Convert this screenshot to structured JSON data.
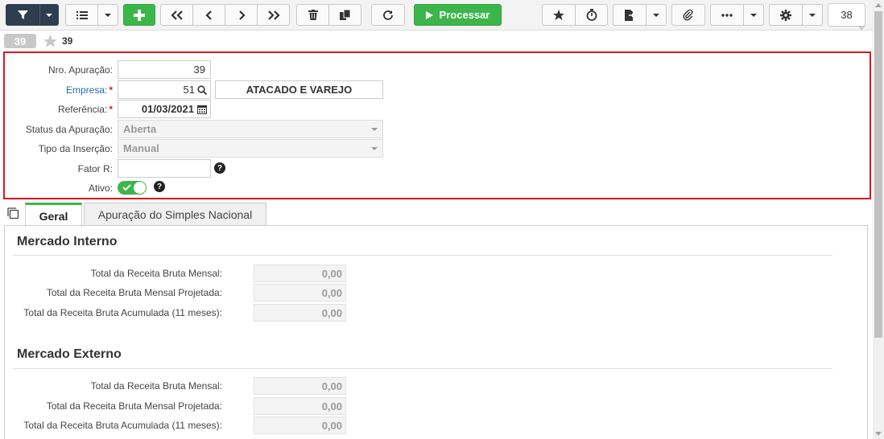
{
  "toolbar": {
    "process_label": "Processar",
    "record_counter": "38",
    "icons": [
      "filter-icon",
      "list-icon",
      "plus-icon",
      "first-icon",
      "prev-icon",
      "next-icon",
      "last-icon",
      "trash-icon",
      "copy-icon",
      "refresh-icon",
      "play-icon",
      "star-icon",
      "stopwatch-icon",
      "export-icon",
      "paperclip-icon",
      "more-icon",
      "gear-icon"
    ]
  },
  "record": {
    "badge": "39",
    "number": "39"
  },
  "header_form": {
    "nro_apuracao": {
      "label": "Nro. Apuração:",
      "value": "39"
    },
    "empresa": {
      "label": "Empresa:",
      "code": "51",
      "name": "ATACADO E VAREJO",
      "required": "*"
    },
    "referencia": {
      "label": "Referência:",
      "value": "01/03/2021",
      "required": "*"
    },
    "status": {
      "label": "Status da Apuração:",
      "value": "Aberta"
    },
    "tipo_insercao": {
      "label": "Tipo da Inserção:",
      "value": "Manual"
    },
    "fator_r": {
      "label": "Fator R:",
      "value": ""
    },
    "ativo": {
      "label": "Ativo:",
      "value": true
    },
    "help_glyph": "?"
  },
  "tabs": [
    {
      "label": "Geral",
      "active": true
    },
    {
      "label": "Apuração do Simples Nacional",
      "active": false
    }
  ],
  "sections": [
    {
      "title": "Mercado Interno",
      "rows": [
        {
          "label": "Total da Receita Bruta Mensal:",
          "value": "0,00"
        },
        {
          "label": "Total da Receita Bruta Mensal Projetada:",
          "value": "0,00"
        },
        {
          "label": "Total da Receita Bruta Acumulada (11 meses):",
          "value": "0,00"
        }
      ]
    },
    {
      "title": "Mercado Externo",
      "rows": [
        {
          "label": "Total da Receita Bruta Mensal:",
          "value": "0,00"
        },
        {
          "label": "Total da Receita Bruta Mensal Projetada:",
          "value": "0,00"
        },
        {
          "label": "Total da Receita Bruta Acumulada (11 meses):",
          "value": "0,00"
        }
      ]
    }
  ],
  "colors": {
    "accent_green": "#3cb64a",
    "dark_button": "#2e3e50",
    "highlight_red": "#e0161e",
    "link_blue": "#2a67b8"
  }
}
